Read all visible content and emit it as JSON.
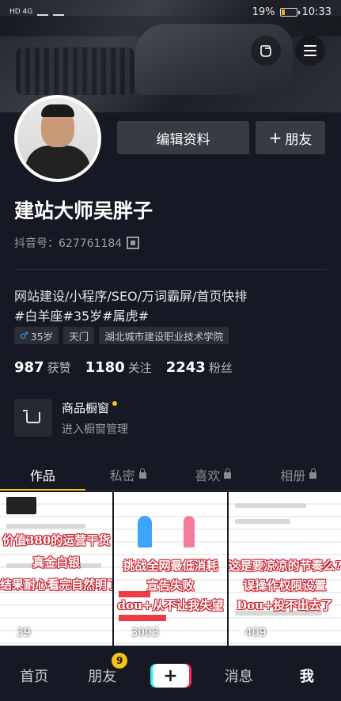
{
  "status_bar": {
    "network": "HD 4G",
    "battery": "19%",
    "time": "10:33"
  },
  "profile": {
    "nickname": "建站大师吴胖子",
    "douyin_id": "抖音号：627761184",
    "edit_label": "编辑资料",
    "add_friend_label": "朋友",
    "bio_line1": "网站建设/小程序/SEO/万词霸屏/首页快排",
    "bio_line2": "#白羊座#35岁#属虎#",
    "tags": {
      "age": "35岁",
      "city": "天门",
      "school": "湖北城市建设职业技术学院"
    },
    "stats": {
      "likes": "987",
      "likes_label": "获赞",
      "following": "1180",
      "following_label": "关注",
      "fans": "2243",
      "fans_label": "粉丝"
    },
    "shop": {
      "title": "商品橱窗",
      "subtitle": "进入橱窗管理"
    }
  },
  "tabs": [
    {
      "label": "作品",
      "locked": false,
      "active": true
    },
    {
      "label": "私密",
      "locked": true
    },
    {
      "label": "喜欢",
      "locked": true
    },
    {
      "label": "相册",
      "locked": true
    }
  ],
  "videos": [
    {
      "line1": "价值380的运营干货",
      "line2": "真金白银",
      "line3": "结果耐心看完自然明了",
      "plays": "39"
    },
    {
      "line1": "挑战全网最低消耗",
      "line2": "宣告失败",
      "line3": "dou+从不让我失望",
      "plays": "3003"
    },
    {
      "line1": "这是要凉凉的节奏么?",
      "line2": "误操作权限设置",
      "line3": "Dou+投不出去了",
      "plays": "409"
    }
  ],
  "bottom_nav": {
    "home": "首页",
    "friends": "朋友",
    "friends_badge": "9",
    "messages": "消息",
    "me": "我"
  },
  "colors": {
    "accent": "#f8c21a",
    "background": "#161823",
    "caption_red": "#c81d2a"
  }
}
